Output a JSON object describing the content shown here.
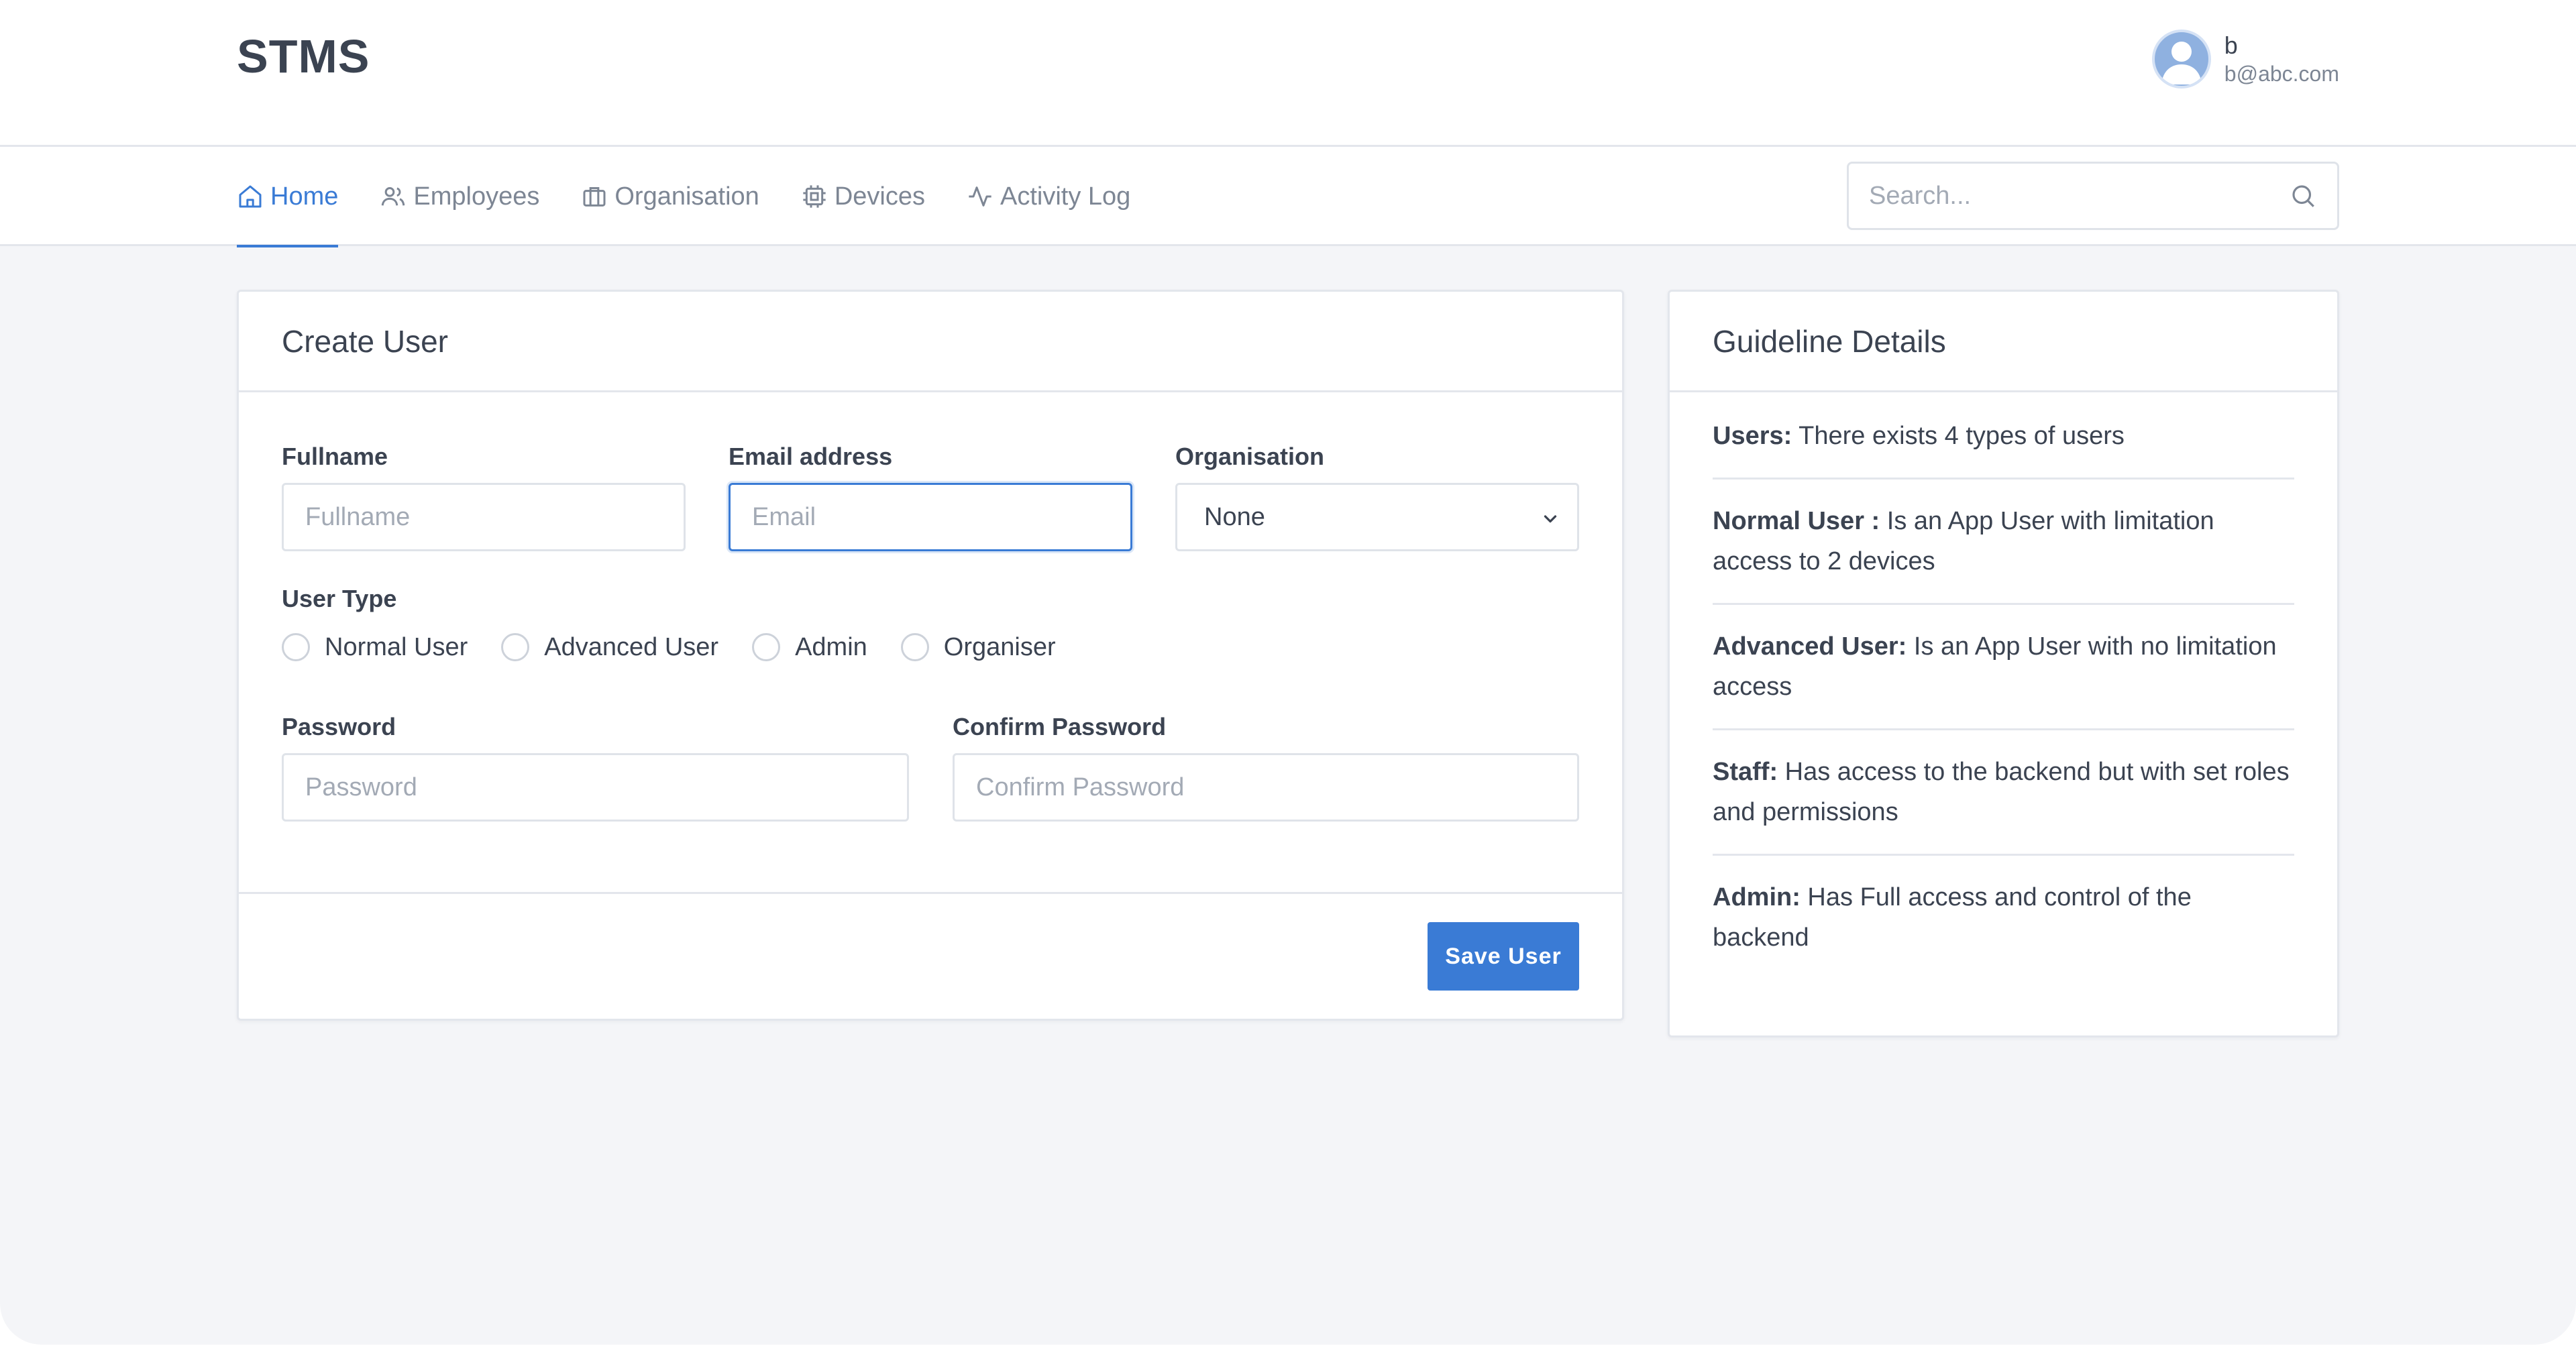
{
  "header": {
    "brand": "STMS",
    "user": {
      "name": "b",
      "email": "b@abc.com"
    }
  },
  "nav": {
    "items": [
      {
        "label": "Home",
        "icon": "home-icon",
        "active": true
      },
      {
        "label": "Employees",
        "icon": "users-icon",
        "active": false
      },
      {
        "label": "Organisation",
        "icon": "briefcase-icon",
        "active": false
      },
      {
        "label": "Devices",
        "icon": "cpu-icon",
        "active": false
      },
      {
        "label": "Activity Log",
        "icon": "activity-icon",
        "active": false
      }
    ],
    "search": {
      "placeholder": "Search...",
      "value": ""
    }
  },
  "create_user": {
    "title": "Create User",
    "fullname": {
      "label": "Fullname",
      "placeholder": "Fullname",
      "value": ""
    },
    "email": {
      "label": "Email address",
      "placeholder": "Email",
      "value": ""
    },
    "organisation": {
      "label": "Organisation",
      "selected": "None"
    },
    "user_type": {
      "label": "User Type",
      "options": [
        "Normal User",
        "Advanced User",
        "Admin",
        "Organiser"
      ]
    },
    "password": {
      "label": "Password",
      "placeholder": "Password",
      "value": ""
    },
    "confirm_password": {
      "label": "Confirm Password",
      "placeholder": "Confirm Password",
      "value": ""
    },
    "save_label": "Save User"
  },
  "guidelines": {
    "title": "Guideline Details",
    "items": [
      {
        "term": "Users:",
        "text": " There exists 4 types of users"
      },
      {
        "term": "Normal User :",
        "text": " Is an App User with limitation access to 2 devices"
      },
      {
        "term": "Advanced User:",
        "text": " Is an App User with no limitation access"
      },
      {
        "term": "Staff:",
        "text": " Has access to the backend but with set roles and permissions"
      },
      {
        "term": "Admin:",
        "text": " Has Full access and control of the backend"
      }
    ]
  },
  "colors": {
    "accent": "#3a7bd5",
    "background": "#f4f5f8",
    "border": "#e3e6ec",
    "text": "#3b4351",
    "muted": "#7d8694"
  }
}
